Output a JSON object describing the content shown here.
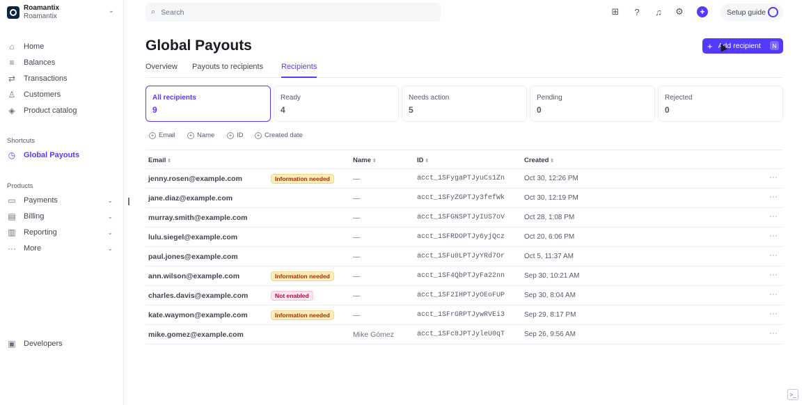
{
  "account": {
    "name": "Roamantix",
    "subname": "Roamantix"
  },
  "nav": {
    "home": "Home",
    "balances": "Balances",
    "transactions": "Transactions",
    "customers": "Customers",
    "product_catalog": "Product catalog",
    "shortcuts_label": "Shortcuts",
    "global_payouts": "Global Payouts",
    "products_label": "Products",
    "payments": "Payments",
    "billing": "Billing",
    "reporting": "Reporting",
    "more": "More",
    "developers": "Developers"
  },
  "topbar": {
    "search_placeholder": "Search",
    "setup_guide": "Setup guide"
  },
  "page": {
    "title": "Global Payouts",
    "add_button": "Add recipient",
    "add_shortcut": "N",
    "tabs": [
      "Overview",
      "Payouts to recipients",
      "Recipients"
    ]
  },
  "cards": [
    {
      "label": "All recipients",
      "count": "9"
    },
    {
      "label": "Ready",
      "count": "4"
    },
    {
      "label": "Needs action",
      "count": "5"
    },
    {
      "label": "Pending",
      "count": "0"
    },
    {
      "label": "Rejected",
      "count": "0"
    }
  ],
  "filters": [
    "Email",
    "Name",
    "ID",
    "Created date"
  ],
  "table": {
    "headers": {
      "email": "Email",
      "name": "Name",
      "id": "ID",
      "created": "Created"
    },
    "rows": [
      {
        "email": "jenny.rosen@example.com",
        "badge": "Information needed",
        "name": "—",
        "id": "acct_1SFygaPTJyuCs1Zn",
        "created": "Oct 30, 12:26 PM"
      },
      {
        "email": "jane.diaz@example.com",
        "badge": "",
        "name": "—",
        "id": "acct_1SFyZGPTJy3fefWk",
        "created": "Oct 30, 12:19 PM"
      },
      {
        "email": "murray.smith@example.com",
        "badge": "",
        "name": "—",
        "id": "acct_1SFGNSPTJyIUS7oV",
        "created": "Oct 28, 1:08 PM"
      },
      {
        "email": "lulu.siegel@example.com",
        "badge": "",
        "name": "—",
        "id": "acct_1SFRDOPTJy6yjQcz",
        "created": "Oct 20, 6:06 PM"
      },
      {
        "email": "paul.jones@example.com",
        "badge": "",
        "name": "—",
        "id": "acct_1SFu0LPTJyYRd7Or",
        "created": "Oct 5, 11:37 AM"
      },
      {
        "email": "ann.wilson@example.com",
        "badge": "Information needed",
        "name": "—",
        "id": "acct_1SF4QbPTJyFa22nn",
        "created": "Sep 30, 10:21 AM"
      },
      {
        "email": "charles.davis@example.com",
        "badge": "Not enabled",
        "name": "—",
        "id": "acct_1SF2IHPTJyOEoFUP",
        "created": "Sep 30, 8:04 AM"
      },
      {
        "email": "kate.waymon@example.com",
        "badge": "Information needed",
        "name": "—",
        "id": "acct_1SFrGRPTJywRVEi3",
        "created": "Sep 29, 8:17 PM"
      },
      {
        "email": "mike.gomez@example.com",
        "badge": "",
        "name": "Mike Gómez",
        "id": "acct_1SFc8JPTJyleU0qT",
        "created": "Sep 26, 9:56 AM"
      }
    ]
  },
  "colors": {
    "accent": "#533afd",
    "warning_bg": "#fcedb9",
    "error_bg": "#ffe7f2"
  }
}
